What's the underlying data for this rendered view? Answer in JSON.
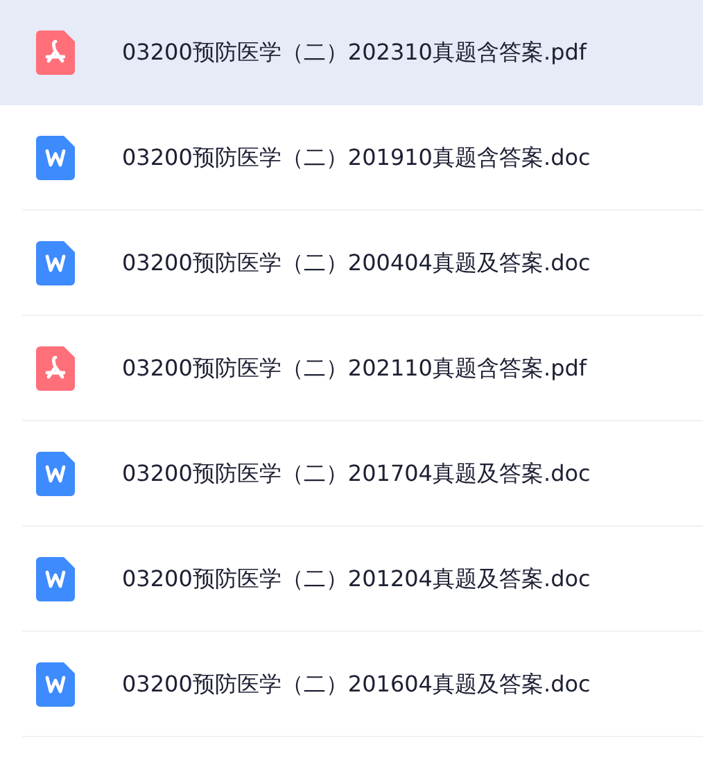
{
  "files": [
    {
      "name": "03200预防医学（二）202310真题含答案.pdf",
      "kind": "pdf",
      "selected": true
    },
    {
      "name": "03200预防医学（二）201910真题含答案.doc",
      "kind": "doc",
      "selected": false
    },
    {
      "name": "03200预防医学（二）200404真题及答案.doc",
      "kind": "doc",
      "selected": false
    },
    {
      "name": "03200预防医学（二）202110真题含答案.pdf",
      "kind": "pdf",
      "selected": false
    },
    {
      "name": "03200预防医学（二）201704真题及答案.doc",
      "kind": "doc",
      "selected": false
    },
    {
      "name": "03200预防医学（二）201204真题及答案.doc",
      "kind": "doc",
      "selected": false
    },
    {
      "name": "03200预防医学（二）201604真题及答案.doc",
      "kind": "doc",
      "selected": false
    }
  ]
}
